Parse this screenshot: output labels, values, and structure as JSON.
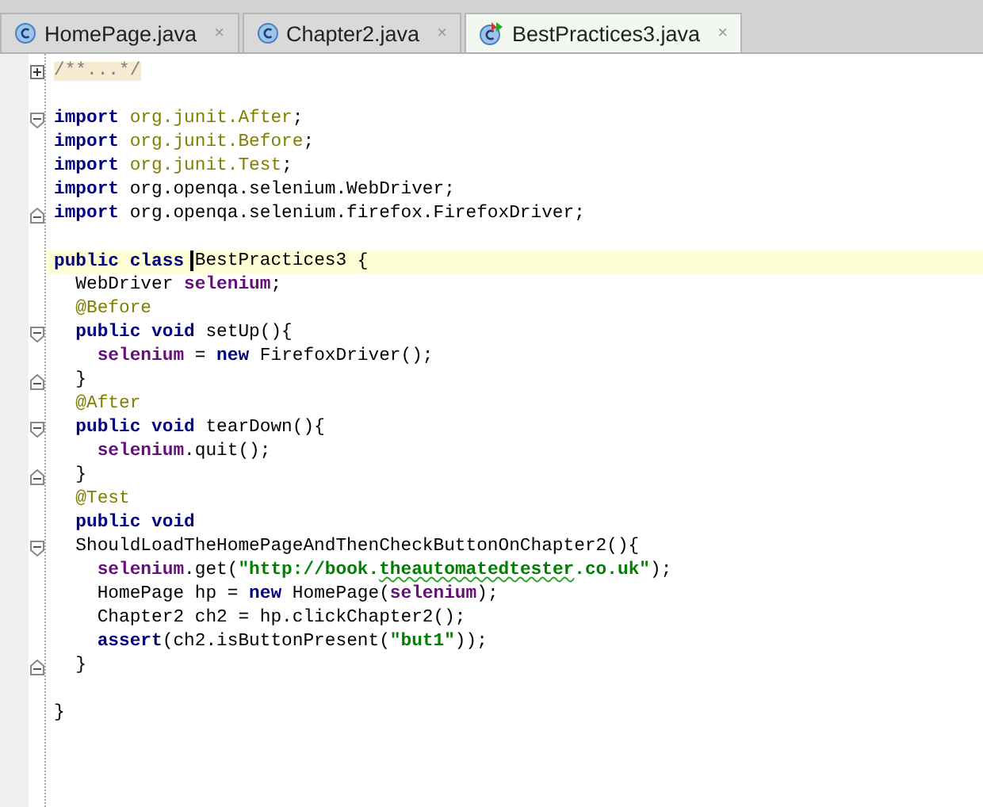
{
  "tabs": [
    {
      "label": "HomePage.java",
      "kind": "class",
      "close": "×",
      "selected": false
    },
    {
      "label": "Chapter2.java",
      "kind": "class",
      "close": "×",
      "selected": false
    },
    {
      "label": "BestPractices3.java",
      "kind": "test",
      "close": "×",
      "selected": true
    }
  ],
  "editor": {
    "lines": [
      {
        "kind": "code",
        "marker": {
          "kind": "expand"
        },
        "tokens": [
          {
            "kind": "folded",
            "text": "/**...*/"
          }
        ]
      },
      {
        "kind": "blank"
      },
      {
        "kind": "code",
        "marker": {
          "kind": "fold-start"
        },
        "tokens": [
          {
            "kind": "kw",
            "text": "import"
          },
          {
            "kind": "pkg",
            "text": " org.junit.After"
          },
          {
            "kind": "plain",
            "text": ";"
          }
        ]
      },
      {
        "kind": "code",
        "tokens": [
          {
            "kind": "kw",
            "text": "import"
          },
          {
            "kind": "pkg",
            "text": " org.junit.Before"
          },
          {
            "kind": "plain",
            "text": ";"
          }
        ]
      },
      {
        "kind": "code",
        "tokens": [
          {
            "kind": "kw",
            "text": "import"
          },
          {
            "kind": "pkg",
            "text": " org.junit.Test"
          },
          {
            "kind": "plain",
            "text": ";"
          }
        ]
      },
      {
        "kind": "code",
        "tokens": [
          {
            "kind": "kw",
            "text": "import"
          },
          {
            "kind": "plain",
            "text": " org.openqa.selenium.WebDriver;"
          }
        ]
      },
      {
        "kind": "code",
        "marker": {
          "kind": "fold-end"
        },
        "tokens": [
          {
            "kind": "kw",
            "text": "import"
          },
          {
            "kind": "plain",
            "text": " org.openqa.selenium.firefox.FirefoxDriver;"
          }
        ]
      },
      {
        "kind": "blank"
      },
      {
        "kind": "code",
        "current": true,
        "tokens": [
          {
            "kind": "kw",
            "text": "public class"
          },
          {
            "kind": "plain",
            "text": " BestPractices3",
            "caret": true
          },
          {
            "kind": "plain",
            "text": " {"
          }
        ]
      },
      {
        "kind": "code",
        "tokens": [
          {
            "kind": "plain",
            "text": "  WebDriver "
          },
          {
            "kind": "field",
            "text": "selenium"
          },
          {
            "kind": "plain",
            "text": ";"
          }
        ]
      },
      {
        "kind": "code",
        "tokens": [
          {
            "kind": "ann",
            "text": "  @Before"
          }
        ]
      },
      {
        "kind": "code",
        "marker": {
          "kind": "fold-start"
        },
        "tokens": [
          {
            "kind": "kw",
            "text": "  public void"
          },
          {
            "kind": "plain",
            "text": " setUp(){"
          }
        ]
      },
      {
        "kind": "code",
        "tokens": [
          {
            "kind": "field",
            "text": "    selenium"
          },
          {
            "kind": "plain",
            "text": " = "
          },
          {
            "kind": "kw",
            "text": "new"
          },
          {
            "kind": "plain",
            "text": " FirefoxDriver();"
          }
        ]
      },
      {
        "kind": "code",
        "marker": {
          "kind": "fold-end"
        },
        "tokens": [
          {
            "kind": "plain",
            "text": "  }"
          }
        ]
      },
      {
        "kind": "code",
        "tokens": [
          {
            "kind": "ann",
            "text": "  @After"
          }
        ]
      },
      {
        "kind": "code",
        "marker": {
          "kind": "fold-start"
        },
        "tokens": [
          {
            "kind": "kw",
            "text": "  public void"
          },
          {
            "kind": "plain",
            "text": " tearDown(){"
          }
        ]
      },
      {
        "kind": "code",
        "tokens": [
          {
            "kind": "field",
            "text": "    selenium"
          },
          {
            "kind": "plain",
            "text": ".quit();"
          }
        ]
      },
      {
        "kind": "code",
        "marker": {
          "kind": "fold-end"
        },
        "tokens": [
          {
            "kind": "plain",
            "text": "  }"
          }
        ]
      },
      {
        "kind": "code",
        "tokens": [
          {
            "kind": "ann",
            "text": "  @Test"
          }
        ]
      },
      {
        "kind": "code",
        "tokens": [
          {
            "kind": "kw",
            "text": "  public void"
          }
        ]
      },
      {
        "kind": "code",
        "marker": {
          "kind": "fold-start"
        },
        "tokens": [
          {
            "kind": "plain",
            "text": "  ShouldLoadTheHomePageAndThenCheckButtonOnChapter2(){"
          }
        ]
      },
      {
        "kind": "code",
        "tokens": [
          {
            "kind": "field",
            "text": "    selenium"
          },
          {
            "kind": "plain",
            "text": ".get("
          },
          {
            "kind": "str",
            "text": "\"http://book."
          },
          {
            "kind": "str",
            "text": "theautomatedtester",
            "warning": true
          },
          {
            "kind": "str",
            "text": ".co.uk\""
          },
          {
            "kind": "plain",
            "text": ");"
          }
        ]
      },
      {
        "kind": "code",
        "tokens": [
          {
            "kind": "plain",
            "text": "    HomePage hp = "
          },
          {
            "kind": "kw",
            "text": "new"
          },
          {
            "kind": "plain",
            "text": " HomePage("
          },
          {
            "kind": "field",
            "text": "selenium"
          },
          {
            "kind": "plain",
            "text": ");"
          }
        ]
      },
      {
        "kind": "code",
        "tokens": [
          {
            "kind": "plain",
            "text": "    Chapter2 ch2 = hp.clickChapter2();"
          }
        ]
      },
      {
        "kind": "code",
        "tokens": [
          {
            "kind": "kw",
            "text": "    assert"
          },
          {
            "kind": "plain",
            "text": "(ch2.isButtonPresent("
          },
          {
            "kind": "str",
            "text": "\"but1\""
          },
          {
            "kind": "plain",
            "text": "));"
          }
        ]
      },
      {
        "kind": "code",
        "marker": {
          "kind": "fold-end"
        },
        "tokens": [
          {
            "kind": "plain",
            "text": "  }"
          }
        ]
      },
      {
        "kind": "blank"
      },
      {
        "kind": "code",
        "tokens": [
          {
            "kind": "plain",
            "text": "}"
          }
        ]
      }
    ]
  }
}
